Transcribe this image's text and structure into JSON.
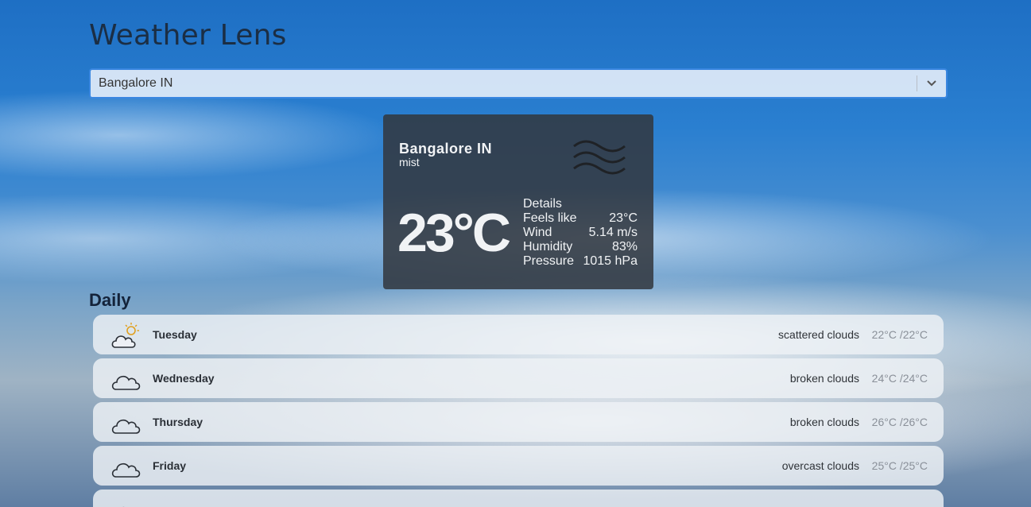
{
  "app": {
    "title": "Weather Lens"
  },
  "search": {
    "selected": "Bangalore IN"
  },
  "current": {
    "city": "Bangalore IN",
    "description": "mist",
    "icon": "mist-icon",
    "temperature": "23°C",
    "details_heading": "Details",
    "details": [
      {
        "label": "Feels like",
        "value": "23°C"
      },
      {
        "label": "Wind",
        "value": "5.14 m/s"
      },
      {
        "label": "Humidity",
        "value": "83%"
      },
      {
        "label": "Pressure",
        "value": "1015 hPa"
      }
    ]
  },
  "daily": {
    "heading": "Daily",
    "days": [
      {
        "name": "Tuesday",
        "condition": "scattered clouds",
        "range": "22°C /22°C",
        "icon": "partly-cloudy-icon"
      },
      {
        "name": "Wednesday",
        "condition": "broken clouds",
        "range": "24°C /24°C",
        "icon": "cloud-icon"
      },
      {
        "name": "Thursday",
        "condition": "broken clouds",
        "range": "26°C /26°C",
        "icon": "cloud-icon"
      },
      {
        "name": "Friday",
        "condition": "overcast clouds",
        "range": "25°C /25°C",
        "icon": "cloud-icon"
      },
      {
        "name": "",
        "condition": "",
        "range": "",
        "icon": "cloud-icon"
      }
    ]
  },
  "colors": {
    "accent": "#3a87e0",
    "card": "#32373e",
    "title": "#1b2e44"
  }
}
